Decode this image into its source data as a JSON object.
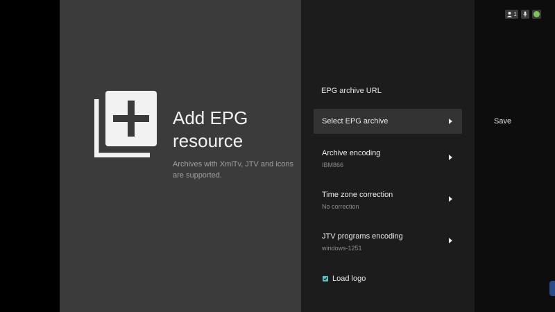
{
  "left": {
    "title": "Add EPG resource",
    "subtitle": "Archives with XmlTv, JTV and icons are supported.",
    "icon": "add-library-icon"
  },
  "form": {
    "header": "EPG archive URL",
    "items": [
      {
        "label": "Select EPG archive",
        "value": "",
        "selected": true
      },
      {
        "label": "Archive encoding",
        "value": "IBM866",
        "selected": false
      },
      {
        "label": "Time zone correction",
        "value": "No correction",
        "selected": false
      },
      {
        "label": "JTV programs encoding",
        "value": "windows-1251",
        "selected": false
      }
    ],
    "load_logo": {
      "label": "Load logo",
      "checked": true
    }
  },
  "actions": {
    "save_label": "Save"
  },
  "status": {
    "user_count": "1",
    "accent_color": "#5fc0c7",
    "online_color": "#7fc25a"
  }
}
